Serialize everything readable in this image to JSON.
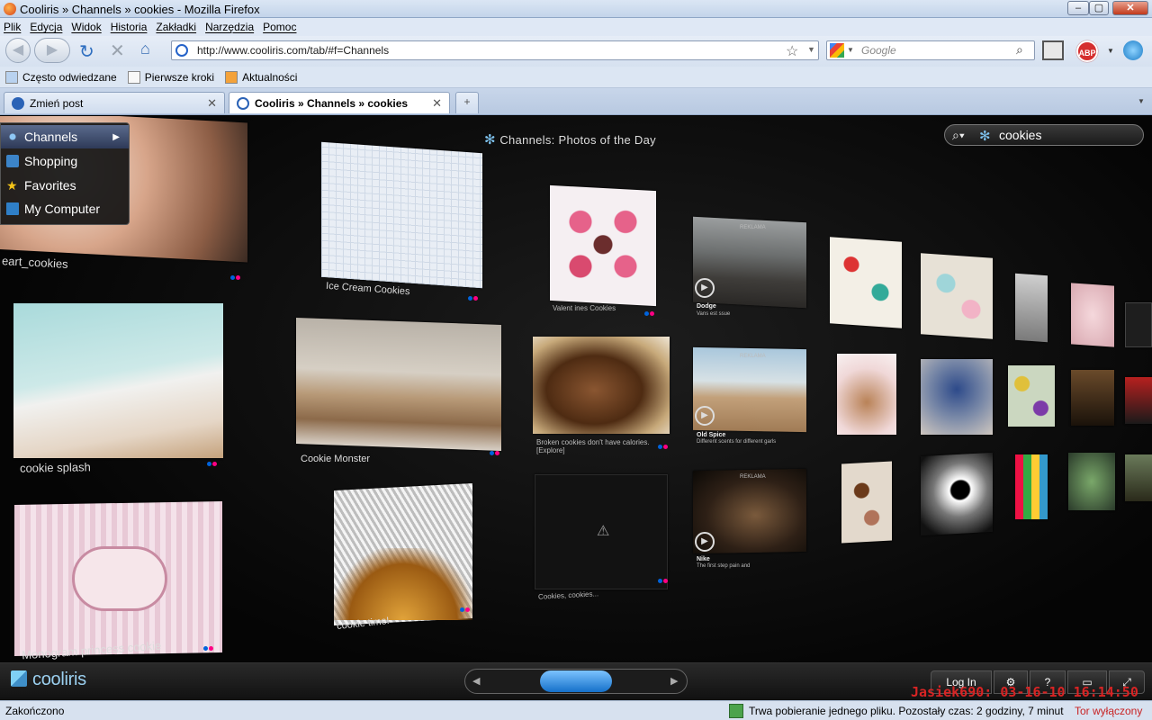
{
  "window": {
    "title": "Cooliris » Channels » cookies - Mozilla Firefox"
  },
  "menu": [
    "Plik",
    "Edycja",
    "Widok",
    "Historia",
    "Zakładki",
    "Narzędzia",
    "Pomoc"
  ],
  "nav": {
    "url": "http://www.cooliris.com/tab/#f=Channels",
    "search_placeholder": "Google",
    "abp": "ABP"
  },
  "bookmarks": [
    "Często odwiedzane",
    "Pierwsze kroki",
    "Aktualności"
  ],
  "tabs": [
    {
      "label": "Zmień post",
      "active": false
    },
    {
      "label": "Cooliris » Channels » cookies",
      "active": true
    }
  ],
  "cooliris": {
    "menu": [
      "Channels",
      "Shopping",
      "Favorites",
      "My Computer"
    ],
    "channel_title": "Channels: Photos of the Day",
    "search_value": "cookies",
    "captions": {
      "heart": "eart_cookies",
      "icecream": "Ice Cream Cookies",
      "valentines": "Valent ines Cookies",
      "dodge_title": "Dodge",
      "dodge_sub": "Vans  est ssue",
      "splash": "cookie splash",
      "monster": "Cookie Monster",
      "broken": "Broken cookies don't have calories. [Explore]",
      "oldspice_title": "Old Spice",
      "oldspice_sub": "Different scents for different garls",
      "monogram": "Monogram princess cookie",
      "cookietime": "cookie time!",
      "cookies": "Cookies, cookies...",
      "nike_title": "Nike",
      "nike_sub": "The first step pain and",
      "ad": "REKLAMA"
    },
    "logo": "cooliris",
    "login": "Log In"
  },
  "stamp": "Jasiek690: 03-16-10 16:14:50",
  "status": {
    "left": "Zakończono",
    "download": "Trwa pobieranie jednego pliku. Pozostały czas: 2 godziny, 7 minut",
    "tor": "Tor wyłączony"
  }
}
